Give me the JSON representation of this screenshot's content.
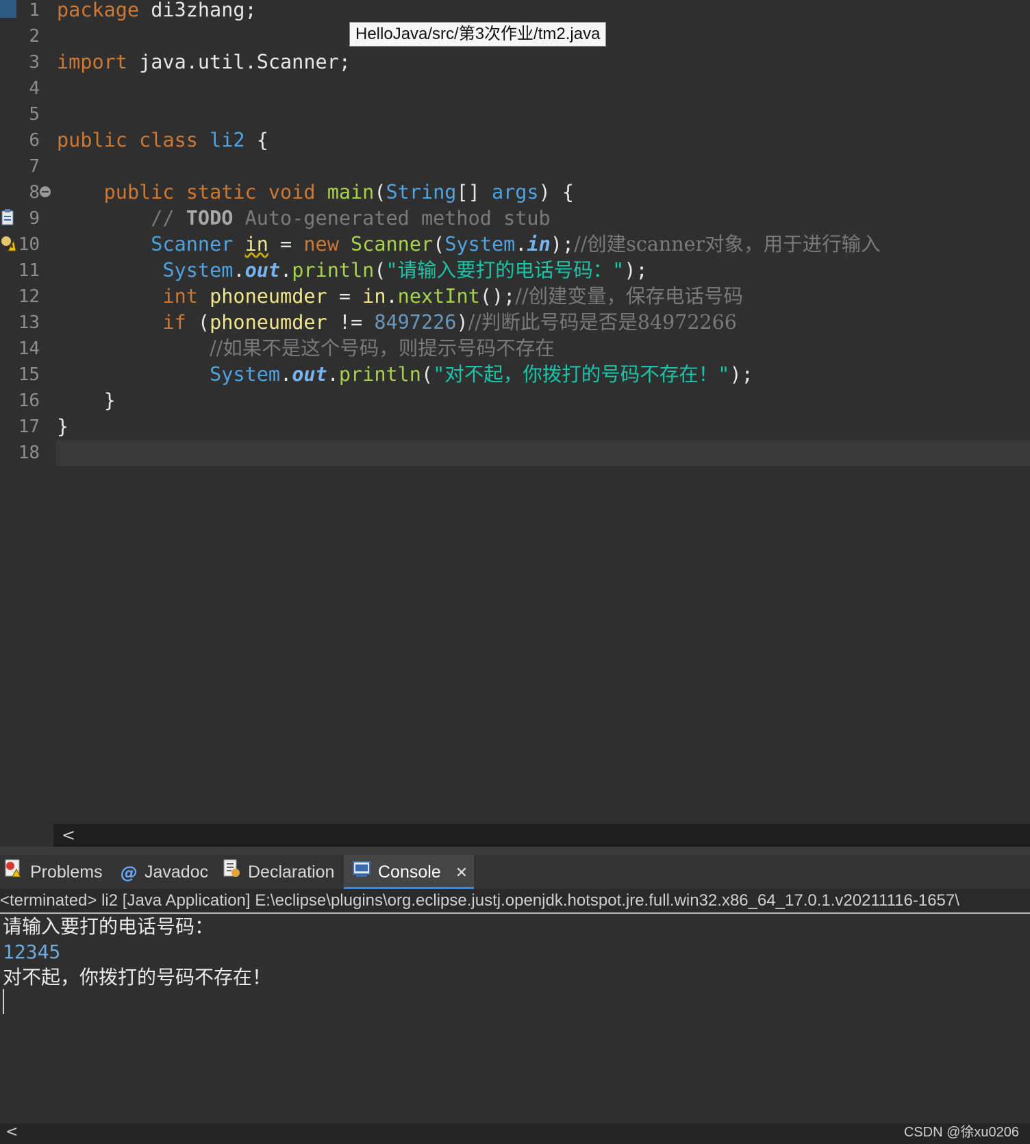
{
  "editor": {
    "file_path_tooltip": "HelloJava/src/第3次作业/tm2.java",
    "line_numbers": [
      "1",
      "2",
      "3",
      "4",
      "5",
      "6",
      "7",
      "8",
      "9",
      "10",
      "11",
      "12",
      "13",
      "14",
      "15",
      "16",
      "17",
      "18"
    ],
    "tokens": {
      "l1_kw": "package",
      "l1_rest": " di3zhang;",
      "l3_kw": "import",
      "l3_rest": " java.util.Scanner;",
      "l6_kw1": "public",
      "l6_kw2": "class",
      "l6_cls": "li2",
      "l6_brace": " {",
      "l8_kw1": "public",
      "l8_kw2": "static",
      "l8_kw3": "void",
      "l8_fn": "main",
      "l8_p1": "(",
      "l8_type": "String",
      "l8_p2": "[] ",
      "l8_args": "args",
      "l8_p3": ") {",
      "l9_cmt1": "// ",
      "l9_todo": "TODO",
      "l9_cmt2": " Auto-generated method stub",
      "l10_type": "Scanner",
      "l10_var": "in",
      "l10_eq": " = ",
      "l10_new": "new",
      "l10_ctor": "Scanner",
      "l10_p1": "(",
      "l10_sys": "System",
      "l10_dot": ".",
      "l10_in": "in",
      "l10_p2": ");",
      "l10_cmt": "//创建scanner对象，用于进行输入",
      "l11_sys": "System",
      "l11_dot": ".",
      "l11_out": "out",
      "l11_dot2": ".",
      "l11_fn": "println",
      "l11_p1": "(",
      "l11_str": "\"请输入要打的电话号码：\"",
      "l11_p2": ");",
      "l12_kw": "int",
      "l12_var": "phoneumder",
      "l12_eq": " = ",
      "l12_in": "in",
      "l12_dot": ".",
      "l12_fn": "nextInt",
      "l12_p": "();",
      "l12_cmt": "//创建变量，保存电话号码",
      "l13_kw": "if",
      "l13_p1": " (",
      "l13_var": "phoneumder",
      "l13_op": " != ",
      "l13_num": "8497226",
      "l13_p2": ")",
      "l13_cmt": "//判断此号码是否是84972266",
      "l14_cmt": "//如果不是这个号码，则提示号码不存在",
      "l15_sys": "System",
      "l15_dot": ".",
      "l15_out": "out",
      "l15_dot2": ".",
      "l15_fn": "println",
      "l15_p1": "(",
      "l15_str": "\"对不起，你拨打的号码不存在！\"",
      "l15_p2": ");",
      "l16": "}",
      "l17": "}"
    }
  },
  "editor_hscroll": {
    "left_arrow": "<"
  },
  "panel": {
    "tabs": [
      {
        "label": "Problems",
        "icon": "problems-icon",
        "active": false
      },
      {
        "label": "Javadoc",
        "icon": "at-icon",
        "active": false
      },
      {
        "label": "Declaration",
        "icon": "declaration-icon",
        "active": false
      },
      {
        "label": "Console",
        "icon": "console-icon",
        "active": true
      }
    ],
    "close_glyph": "✕"
  },
  "console": {
    "header": "<terminated> li2 [Java Application] E:\\eclipse\\plugins\\org.eclipse.justj.openjdk.hotspot.jre.full.win32.x86_64_17.0.1.v20211116-1657\\",
    "lines": [
      "请输入要打的电话号码：",
      "12345",
      "对不起，你拨打的号码不存在！"
    ]
  },
  "bottom_scroll": {
    "left_arrow": "<"
  },
  "watermark": "CSDN @徐xu0206",
  "colors": {
    "background": "#2f2f2f",
    "keyword": "#cc7832",
    "type": "#4fa3e0",
    "method": "#a9d24b",
    "variable": "#f0e68c",
    "string": "#19c4a8",
    "comment": "#7a7a7a",
    "active_tab_underline": "#3a8be0"
  }
}
